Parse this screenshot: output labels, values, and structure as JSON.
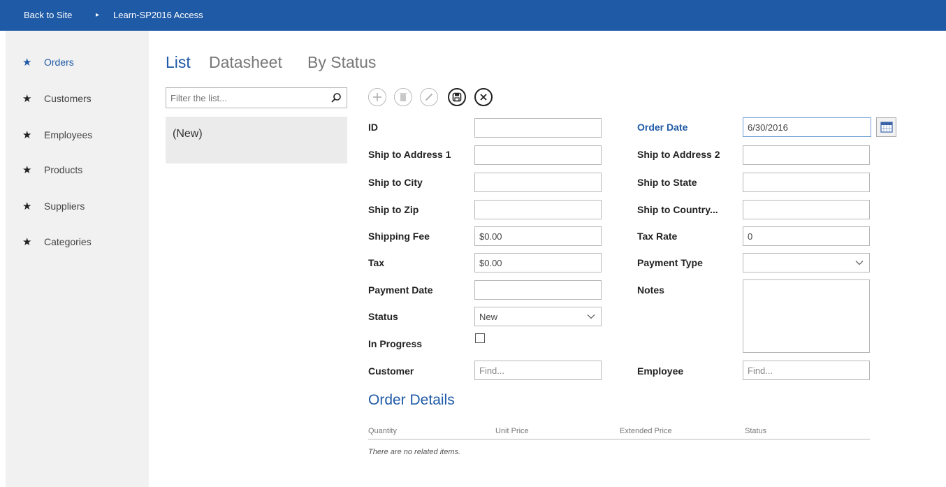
{
  "topbar": {
    "back_label": "Back to Site",
    "separator": "▸",
    "site_label": "Learn-SP2016 Access"
  },
  "sidebar": {
    "items": [
      {
        "label": "Orders",
        "active": true
      },
      {
        "label": "Customers"
      },
      {
        "label": "Employees"
      },
      {
        "label": "Products"
      },
      {
        "label": "Suppliers"
      },
      {
        "label": "Categories"
      }
    ]
  },
  "tabs": [
    {
      "label": "List",
      "active": true
    },
    {
      "label": "Datasheet"
    },
    {
      "label": "By Status"
    }
  ],
  "filter": {
    "placeholder": "Filter the list..."
  },
  "list": {
    "items": [
      "(New)"
    ]
  },
  "toolbar": {
    "icons": [
      "add-icon",
      "delete-icon",
      "edit-icon",
      "save-icon",
      "cancel-icon"
    ]
  },
  "form": {
    "id_label": "ID",
    "ship_address1_label": "Ship to Address 1",
    "ship_city_label": "Ship to City",
    "ship_zip_label": "Ship to Zip",
    "shipping_fee_label": "Shipping Fee",
    "shipping_fee_value": "$0.00",
    "tax_label": "Tax",
    "tax_value": "$0.00",
    "payment_date_label": "Payment Date",
    "status_label": "Status",
    "status_value": "New",
    "in_progress_label": "In Progress",
    "customer_label": "Customer",
    "customer_placeholder": "Find...",
    "order_date_label": "Order Date",
    "order_date_value": "6/30/2016",
    "ship_address2_label": "Ship to Address 2",
    "ship_state_label": "Ship to State",
    "ship_country_label": "Ship to Country...",
    "tax_rate_label": "Tax Rate",
    "tax_rate_value": "0",
    "payment_type_label": "Payment Type",
    "notes_label": "Notes",
    "employee_label": "Employee",
    "employee_placeholder": "Find..."
  },
  "order_details": {
    "title": "Order Details",
    "columns": [
      "Quantity",
      "Unit Price",
      "Extended Price",
      "Status"
    ],
    "empty_message": "There are no related items."
  },
  "colors": {
    "brand": "#1f5aa6",
    "sidebar_bg": "#f1f1f1"
  }
}
